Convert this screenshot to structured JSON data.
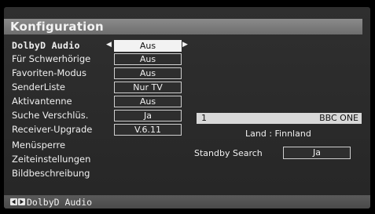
{
  "header": {
    "title": "Konfiguration"
  },
  "menu": {
    "items": [
      {
        "label": "DolbyD Audio",
        "value": "Aus"
      },
      {
        "label": "Für Schwerhörige",
        "value": "Aus"
      },
      {
        "label": "Favoriten-Modus",
        "value": "Aus"
      },
      {
        "label": "SenderListe",
        "value": "Nur TV"
      },
      {
        "label": "Aktivantenne",
        "value": "Aus"
      },
      {
        "label": "Suche Verschlüs.",
        "value": "Ja"
      },
      {
        "label": "Receiver-Upgrade",
        "value": "V.6.11"
      },
      {
        "label": "Menüsperre"
      },
      {
        "label": "Zeiteinstellungen"
      },
      {
        "label": "Bildbeschreibung"
      }
    ]
  },
  "info": {
    "channel_number": "1",
    "channel_name": "BBC ONE",
    "country": "Land : Finnland",
    "standby_label": "Standby Search",
    "standby_value": "Ja"
  },
  "status_bar": {
    "text": "DolbyD Audio",
    "icons": [
      "arrow-left-icon",
      "arrow-right-icon"
    ]
  },
  "colors": {
    "background": "#000000",
    "panel": "#2a2a2a",
    "title_bar": "#7a7a7a",
    "text": "#f0f0f0",
    "highlight": "#f2f2f2"
  }
}
